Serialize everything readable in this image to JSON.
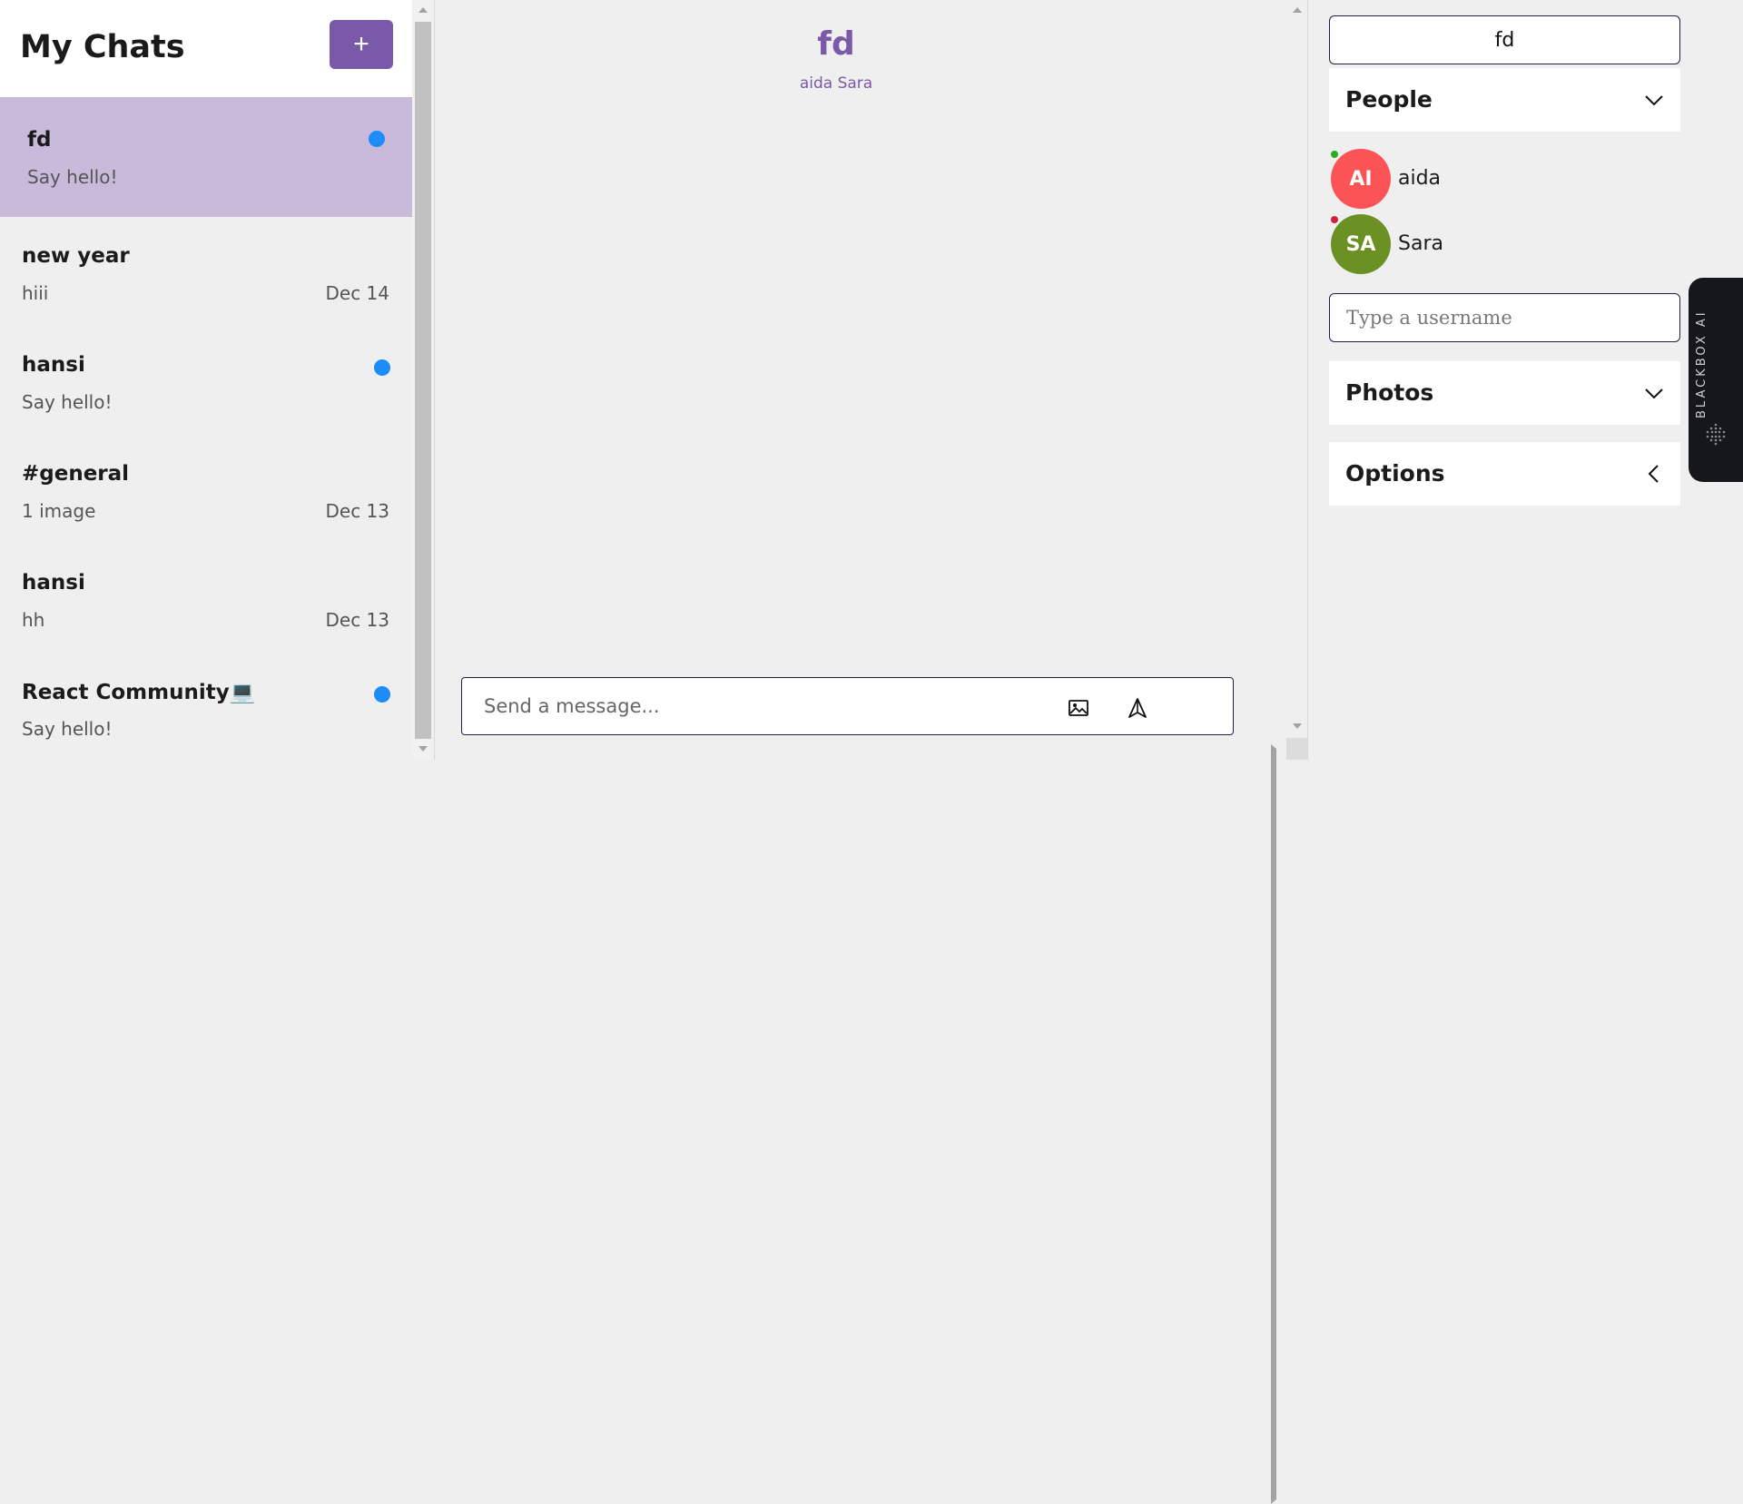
{
  "sidebar": {
    "title": "My Chats",
    "new_chat_symbol": "+",
    "chats": [
      {
        "title": "fd",
        "preview": "Say hello!",
        "date": "",
        "unread": true,
        "active": true
      },
      {
        "title": "new year",
        "preview": "hiii",
        "date": "Dec 14",
        "unread": false,
        "active": false
      },
      {
        "title": "hansi",
        "preview": "Say hello!",
        "date": "",
        "unread": true,
        "active": false
      },
      {
        "title": "#general",
        "preview": "1 image",
        "date": "Dec 13",
        "unread": false,
        "active": false
      },
      {
        "title": "hansi",
        "preview": "hh",
        "date": "Dec 13",
        "unread": false,
        "active": false
      },
      {
        "title": "React Community💻",
        "preview": "Say hello!",
        "date": "",
        "unread": true,
        "active": false
      }
    ]
  },
  "chat": {
    "title": "fd",
    "members": "aida Sara",
    "message_placeholder": "Send a message...",
    "icons": {
      "attach": "image-icon",
      "send": "send-icon"
    }
  },
  "settings": {
    "title_value": "fd",
    "people_label": "People",
    "people": [
      {
        "initials": "AI",
        "name": "aida",
        "avatar_color": "#fb5356",
        "status_color": "#26b01b"
      },
      {
        "initials": "SA",
        "name": "Sara",
        "avatar_color": "#6b9124",
        "status_color": "#d1213f"
      }
    ],
    "username_placeholder": "Type a username",
    "photos_label": "Photos",
    "options_label": "Options"
  },
  "blackbox": {
    "label": "BLACKBOX AI"
  },
  "colors": {
    "accent": "#7b59a9",
    "active_chat": "#c9badc",
    "unread_dot": "#1d8cf8"
  }
}
